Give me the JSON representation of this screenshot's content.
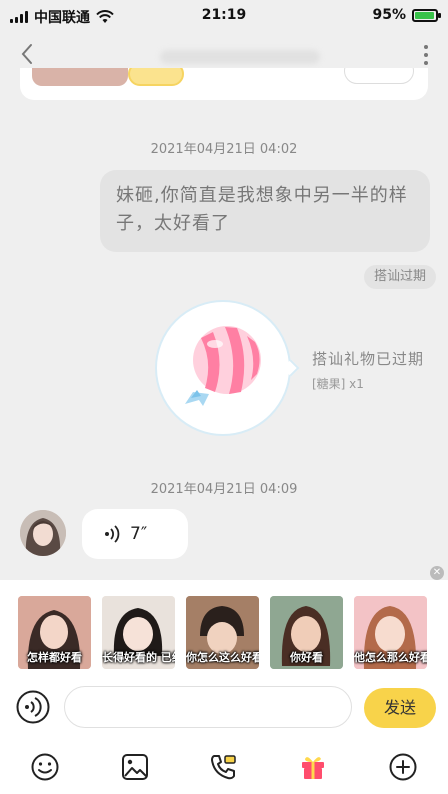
{
  "status_bar": {
    "carrier": "中国联通",
    "time": "21:19",
    "battery": "95%",
    "battery_level": 0.95
  },
  "chat": {
    "timestamp_1": "2021年04月21日 04:02",
    "message_text": "妹砸,你简直是我想象中另一半的样子，太好看了",
    "expired_tag": "搭讪过期",
    "gift_title": "搭讪礼物已过期",
    "gift_sub": "[糖果] x1",
    "timestamp_2": "2021年04月21日 04:09",
    "voice_duration": "7″"
  },
  "stickers": [
    {
      "caption": "怎样都好看",
      "bg": "#e8b7a6"
    },
    {
      "caption": "长得好看的 已经到家了",
      "bg": "#efe6df"
    },
    {
      "caption": "你怎么这么好看",
      "bg": "#b98f74"
    },
    {
      "caption": "你好看",
      "bg": "#9fb6a0"
    },
    {
      "caption": "他怎么那么好看",
      "bg": "#f4c6c6"
    }
  ],
  "composer": {
    "input_value": "",
    "input_placeholder": "",
    "send_label": "发送"
  },
  "colors": {
    "accent": "#f8d34a",
    "gift": "#ff4d6d"
  },
  "toolbar_icons": [
    "emoji-icon",
    "image-icon",
    "call-icon",
    "gift-icon",
    "plus-icon"
  ]
}
